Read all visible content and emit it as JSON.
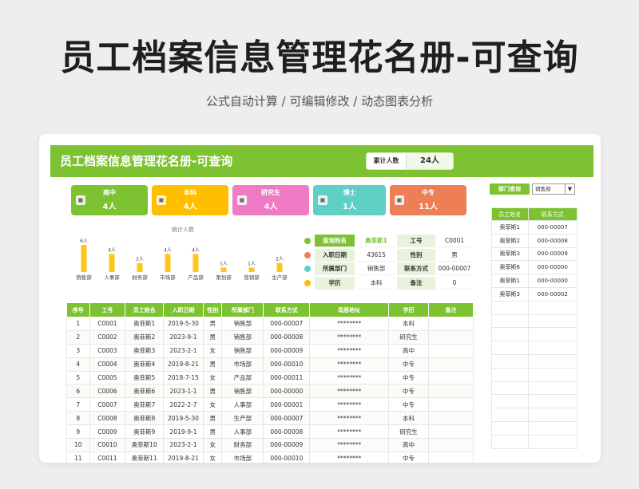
{
  "hero": {
    "title": "员工档案信息管理花名册-可查询",
    "subtitle": "公式自动计算 /  可编辑修改  / 动态图表分析"
  },
  "header": {
    "title": "员工档案信息管理花名册-可查询",
    "total_label": "累计人数",
    "total_value": "24人"
  },
  "tiles": [
    {
      "name": "高中",
      "count": "4人",
      "color": "#7cc231"
    },
    {
      "name": "本科",
      "count": "4人",
      "color": "#ffbf00"
    },
    {
      "name": "研究生",
      "count": "4人",
      "color": "#ee7bc3"
    },
    {
      "name": "博士",
      "count": "1人",
      "color": "#5fd0c4"
    },
    {
      "name": "中专",
      "count": "11人",
      "color": "#ee7e55"
    }
  ],
  "chart_data": {
    "type": "bar",
    "title": "统计人数",
    "categories": [
      "销售部",
      "人事部",
      "财务部",
      "市场部",
      "产品部",
      "策划部",
      "营销部",
      "生产部"
    ],
    "values": [
      6,
      4,
      2,
      4,
      4,
      1,
      1,
      2
    ],
    "data_labels": [
      "6人",
      "4人",
      "2人",
      "4人",
      "4人",
      "1人",
      "1人",
      "2人"
    ],
    "ylim": [
      0,
      6
    ],
    "bar_color": "#ffc61a",
    "grid": false
  },
  "query": {
    "rows": [
      {
        "k1": "查询姓名",
        "v1": "奥菲斯1",
        "k2": "工号",
        "v2": "C0001"
      },
      {
        "k1": "入职日期",
        "v1": "43615",
        "k2": "性别",
        "v2": "男"
      },
      {
        "k1": "所属部门",
        "v1": "销售部",
        "k2": "联系方式",
        "v2": "000-00007"
      },
      {
        "k1": "学历",
        "v1": "本科",
        "k2": "备注",
        "v2": "0"
      }
    ],
    "icon_colors": [
      "#7cc231",
      "#ee7e55",
      "#5fd0c4",
      "#ffbf00"
    ]
  },
  "dept_query": {
    "button": "部门查询",
    "selected": "销售部",
    "headers": [
      "员工姓名",
      "联系方式"
    ],
    "rows": [
      [
        "奥菲斯1",
        "000-00007"
      ],
      [
        "奥菲斯2",
        "000-00008"
      ],
      [
        "奥菲斯3",
        "000-00009"
      ],
      [
        "奥菲斯6",
        "000-00000"
      ],
      [
        "奥菲斯1",
        "000-00000"
      ],
      [
        "奥菲斯3",
        "000-00002"
      ]
    ]
  },
  "table": {
    "headers": [
      "序号",
      "工号",
      "员工姓名",
      "入职日期",
      "性别",
      "所属部门",
      "联系方式",
      "现居地址",
      "学历",
      "备注"
    ],
    "rows": [
      [
        "1",
        "C0001",
        "奥菲斯1",
        "2019-5-30",
        "男",
        "销售部",
        "000-00007",
        "********",
        "本科",
        ""
      ],
      [
        "2",
        "C0002",
        "奥菲斯2",
        "2023-9-1",
        "男",
        "销售部",
        "000-00008",
        "********",
        "研究生",
        ""
      ],
      [
        "3",
        "C0003",
        "奥菲斯3",
        "2023-2-1",
        "女",
        "销售部",
        "000-00009",
        "********",
        "高中",
        ""
      ],
      [
        "4",
        "C0004",
        "奥菲斯4",
        "2019-8-21",
        "男",
        "市场部",
        "000-00010",
        "********",
        "中专",
        ""
      ],
      [
        "5",
        "C0005",
        "奥菲斯5",
        "2018-7-15",
        "女",
        "产品部",
        "000-00011",
        "********",
        "中专",
        ""
      ],
      [
        "6",
        "C0006",
        "奥菲斯6",
        "2023-1-1",
        "男",
        "销售部",
        "000-00000",
        "********",
        "中专",
        ""
      ],
      [
        "7",
        "C0007",
        "奥菲斯7",
        "2022-2-7",
        "女",
        "人事部",
        "000-00001",
        "********",
        "中专",
        ""
      ],
      [
        "8",
        "C0008",
        "奥菲斯8",
        "2019-5-30",
        "男",
        "生产部",
        "000-00007",
        "********",
        "本科",
        ""
      ],
      [
        "9",
        "C0009",
        "奥菲斯9",
        "2019-9-1",
        "男",
        "人事部",
        "000-00008",
        "********",
        "研究生",
        ""
      ],
      [
        "10",
        "C0010",
        "奥菲斯10",
        "2023-2-1",
        "女",
        "财务部",
        "000-00009",
        "********",
        "高中",
        ""
      ],
      [
        "11",
        "C0011",
        "奥菲斯11",
        "2019-8-21",
        "女",
        "市场部",
        "000-00010",
        "********",
        "中专",
        ""
      ]
    ]
  }
}
